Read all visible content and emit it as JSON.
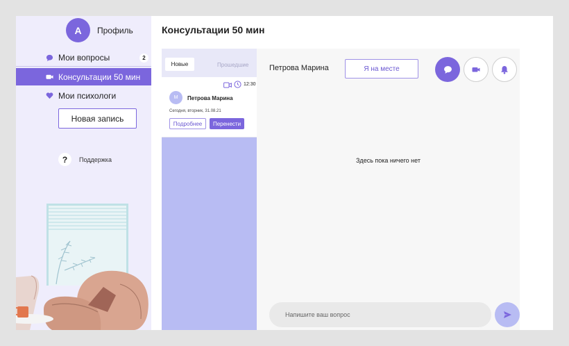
{
  "window": {
    "title": "Консультации 50 мин"
  },
  "profile": {
    "avatar_letter": "А",
    "label": "Профиль"
  },
  "sidebar": {
    "items": [
      {
        "label": "Мои вопросы",
        "icon": "chat-bubble-icon",
        "badge": "2"
      },
      {
        "label": "Консультации 50 мин",
        "icon": "video-camera-icon",
        "active": true
      },
      {
        "label": "Мои психологи",
        "icon": "heart-icon"
      }
    ],
    "new_button": "Новая запись",
    "support": {
      "icon": "?",
      "label": "Поддержка"
    }
  },
  "list": {
    "tabs": [
      {
        "label": "Новые",
        "active": true
      },
      {
        "label": "Прошедшие"
      }
    ],
    "cards": [
      {
        "time": "12:30",
        "avatar_letter": "М",
        "name": "Петрова Марина",
        "date": "Сегодня, вторник, 31.08.21",
        "details_button": "Подробнее",
        "reschedule_button": "Перенести"
      }
    ]
  },
  "chat": {
    "contact_name": "Петрова Марина",
    "here_button": "Я на месте",
    "empty_text": "Здесь пока ничего нет",
    "input_placeholder": "Напишите ваш вопрос"
  },
  "colors": {
    "accent": "#7b66dd",
    "list_bg": "#b8bcf3",
    "sidebar_bg": "#efedfc",
    "page_bg": "#e3e3e3"
  }
}
